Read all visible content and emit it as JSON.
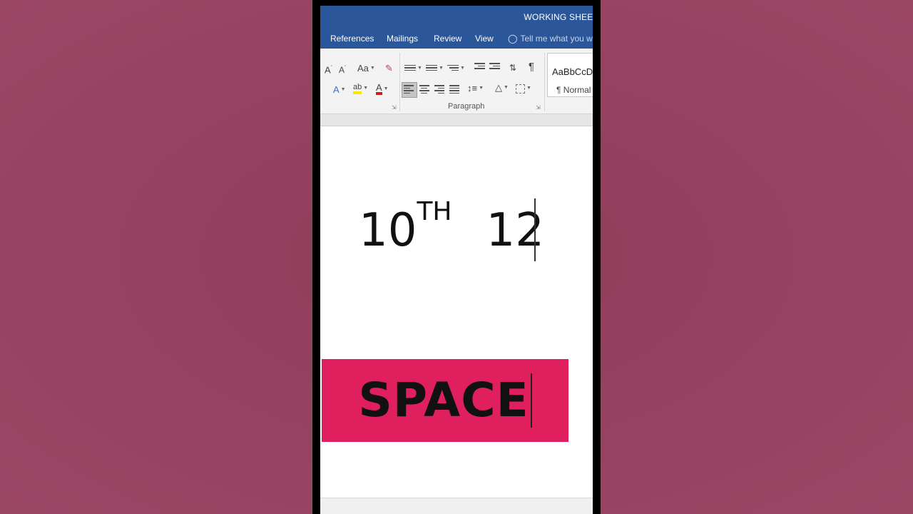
{
  "window": {
    "title": "WORKING SHEET"
  },
  "tabs": [
    {
      "label": "References"
    },
    {
      "label": "Mailings"
    },
    {
      "label": "Review"
    },
    {
      "label": "View"
    }
  ],
  "tell_me": {
    "placeholder": "Tell me what you w"
  },
  "ribbon": {
    "font_case_label": "Aa",
    "paragraph_group_label": "Paragraph",
    "pilcrow": "¶",
    "styles": {
      "sample": "AaBbCcD",
      "name": "¶ Normal"
    }
  },
  "document": {
    "line1_base": "10",
    "line1_sup": "TH",
    "line1_after": "12"
  },
  "banner": {
    "text": "SPACE",
    "color": "#e01f5f"
  },
  "colors": {
    "title_bar": "#2b579a",
    "background": "#934260"
  }
}
